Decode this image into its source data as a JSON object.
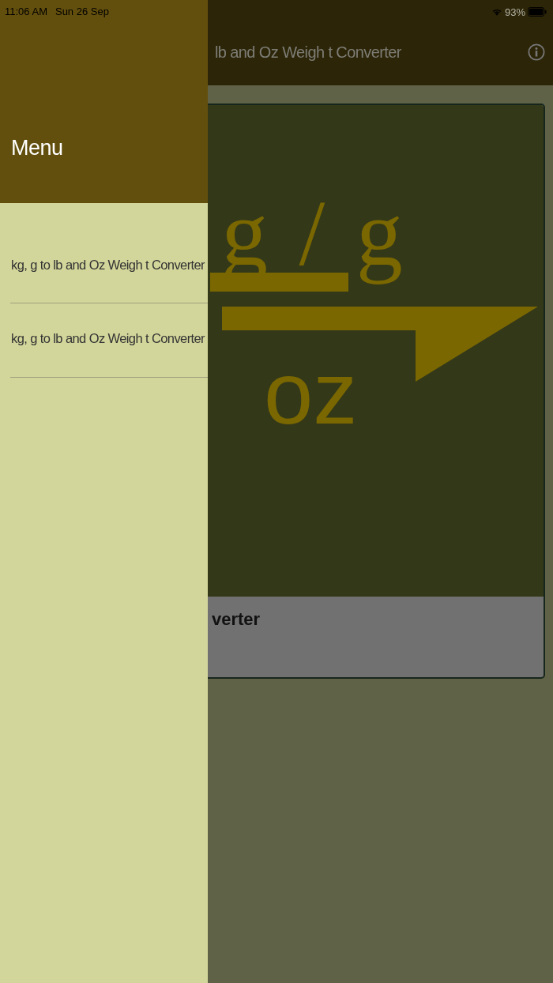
{
  "status_bar": {
    "time": "11:06 AM",
    "date": "Sun 26 Sep",
    "battery": "93%"
  },
  "header": {
    "title": "lb and Oz Weigh t Converter"
  },
  "card": {
    "image_top": "g / g",
    "image_bottom": "oz",
    "caption": "verter"
  },
  "drawer": {
    "title": "Menu",
    "items": [
      {
        "label": "kg, g to lb and Oz Weigh t Converter"
      },
      {
        "label": "kg, g to lb and Oz Weigh t Converter"
      }
    ]
  }
}
